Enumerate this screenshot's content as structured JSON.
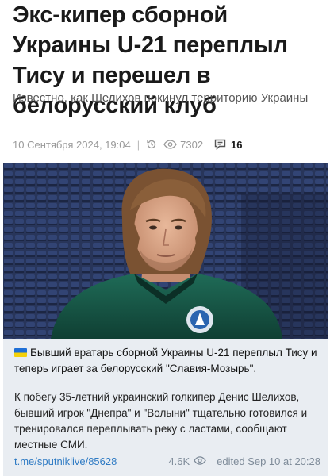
{
  "article": {
    "title": "Экс-кипер сборной Украины U-21 переплыл Тису и перешел в белорусский клуб",
    "subtitle": "Известно, как Шелихов покинул территорию Украины",
    "date": "10 Сентября 2024, 19:04",
    "views": "7302",
    "comments": "16"
  },
  "message": {
    "headline": "Бывший вратарь сборной Украины U-21 переплыл Тису и теперь играет за белорусский \"Славия-Мозырь\".",
    "body": "К побегу 35-летний украинский голкипер Денис Шелихов, бывший игрок \"Днепра\" и \"Волыни\" тщательно готовился и тренировался переплывать реку с ластами, сообщают местные СМИ.",
    "link": "t.me/sputniklive/85628",
    "views": "4.6K",
    "edited": "edited Sep 10 at 20:28"
  },
  "icons": {
    "history": "history-icon",
    "views": "eye-icon",
    "comments": "comment-icon",
    "flag": "ukraine-flag-icon"
  },
  "colors": {
    "link": "#2f7bc4",
    "message_bg": "#e9edf2",
    "meta_text": "#9a9a9a"
  }
}
